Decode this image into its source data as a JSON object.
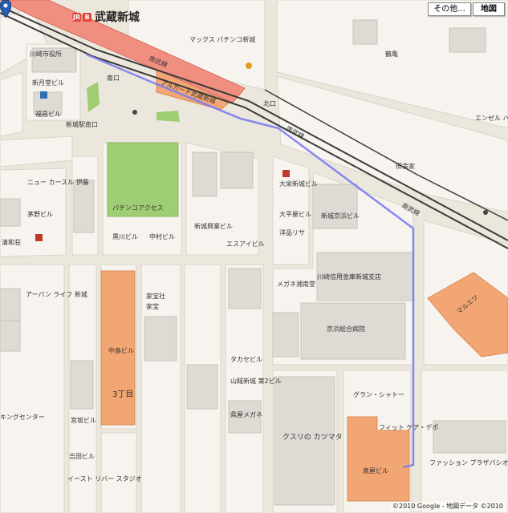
{
  "colors": {
    "background": "#ece7dc",
    "block": "#f7f4ef",
    "building": "#dedbd5",
    "highlight_building": "#f2a673",
    "park": "#9fcd73",
    "rail": "#3a3a3a",
    "station_platform": "#f08f80",
    "route": "#7b7cf0"
  },
  "controls": {
    "more_label": "その他...",
    "map_label": "地図"
  },
  "station": {
    "name": "武蔵新城",
    "icon_jr": "JR",
    "icon_bus": "B"
  },
  "labels": [
    {
      "text": "新城駅南口",
      "kind": "place"
    },
    {
      "text": "南口",
      "kind": "place"
    },
    {
      "text": "北口",
      "kind": "place"
    },
    {
      "text": "南武線",
      "kind": "rail"
    },
    {
      "text": "南武線",
      "kind": "rail"
    },
    {
      "text": "南武線",
      "kind": "rail"
    },
    {
      "text": "アルカード武蔵新城",
      "kind": "building"
    },
    {
      "text": "マックス パチンコ新城",
      "kind": "building"
    },
    {
      "text": "新月堂ビル",
      "kind": "building"
    },
    {
      "text": "福昌ビル",
      "kind": "building"
    },
    {
      "text": "川崎市役所",
      "kind": "building"
    },
    {
      "text": "パチンコアクセス",
      "kind": "building"
    },
    {
      "text": "黒川ビル",
      "kind": "building"
    },
    {
      "text": "中村ビル",
      "kind": "building"
    },
    {
      "text": "新城興業ビル",
      "kind": "building"
    },
    {
      "text": "エスアイビル",
      "kind": "building"
    },
    {
      "text": "大栄新城ビル",
      "kind": "building"
    },
    {
      "text": "大平屋ビル",
      "kind": "building"
    },
    {
      "text": "洋品リサ",
      "kind": "building"
    },
    {
      "text": "新城京浜ビル",
      "kind": "building"
    },
    {
      "text": "川崎信用金庫新城支店",
      "kind": "building"
    },
    {
      "text": "メガネ湘南堂",
      "kind": "building"
    },
    {
      "text": "京浜総合病院",
      "kind": "building"
    },
    {
      "text": "マルエツ",
      "kind": "building"
    },
    {
      "text": "中島ビル",
      "kind": "building"
    },
    {
      "text": "3丁目",
      "kind": "district"
    },
    {
      "text": "タカセビル",
      "kind": "building"
    },
    {
      "text": "山賊新城 第2ビル",
      "kind": "building"
    },
    {
      "text": "県屋メガネ",
      "kind": "building"
    },
    {
      "text": "グラン・シャトー",
      "kind": "building"
    },
    {
      "text": "クスリの カツマタ",
      "kind": "building"
    },
    {
      "text": "フィット ケア・デポ",
      "kind": "building"
    },
    {
      "text": "泉屋ビル",
      "kind": "building"
    },
    {
      "text": "ファッション プラザパシオス 新城店",
      "kind": "building"
    },
    {
      "text": "ニュー カースル 伊藤",
      "kind": "building"
    },
    {
      "text": "茅野ビル",
      "kind": "building"
    },
    {
      "text": "清和荘",
      "kind": "building"
    },
    {
      "text": "アーバン ライフ 新城",
      "kind": "building"
    },
    {
      "text": "キングセンター",
      "kind": "building"
    },
    {
      "text": "宮坂ビル",
      "kind": "building"
    },
    {
      "text": "吉田ビル",
      "kind": "building"
    },
    {
      "text": "イースト リバー スタジオ",
      "kind": "building"
    },
    {
      "text": "エンゼル ハイム 武蔵新城",
      "kind": "building"
    },
    {
      "text": "鶴亀",
      "kind": "building"
    },
    {
      "text": "田舎家",
      "kind": "building"
    },
    {
      "text": "家宝社",
      "kind": "building"
    },
    {
      "text": "家宝",
      "kind": "building"
    }
  ],
  "copyright": "©2010 Google - 地図データ ©2010"
}
